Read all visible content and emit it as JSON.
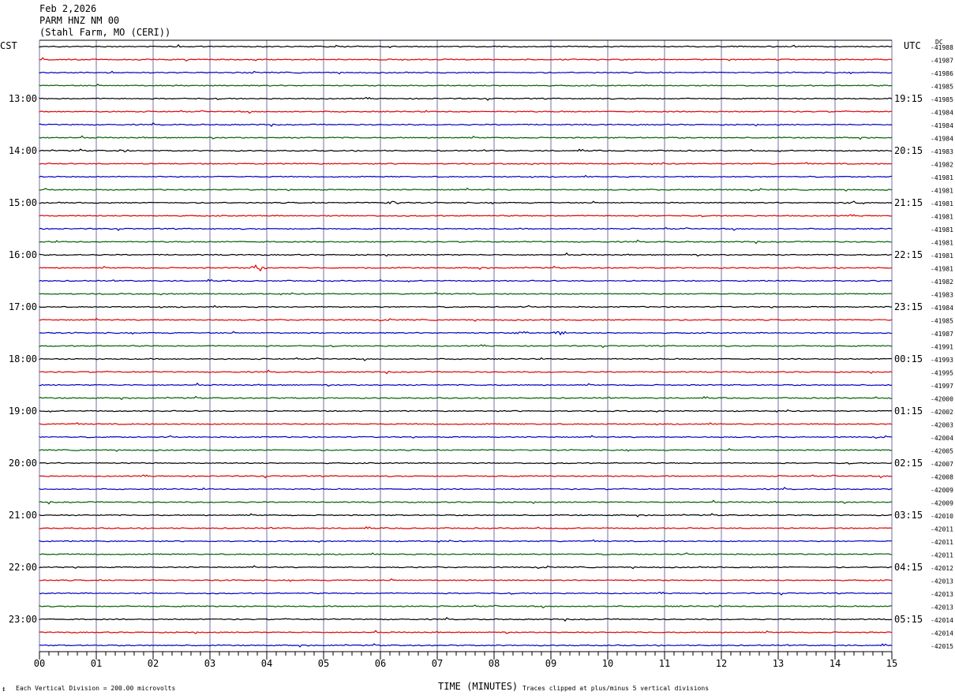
{
  "header": {
    "date": "Feb 2,2026",
    "station": "PARM HNZ NM 00",
    "location": "(Stahl Farm, MO (CERI))"
  },
  "labels": {
    "left_zone": "CST",
    "right_zone": "UTC",
    "dc": "DC",
    "xlabel": "TIME (MINUTES)",
    "scale_note": "Each Vertical Division =  200.00 microvolts",
    "clip_note": "Traces clipped at plus/minus 5 vertical divisions",
    "mark": "↕"
  },
  "chart_data": {
    "type": "line",
    "title": "PARM HNZ NM 00",
    "xlabel": "TIME (MINUTES)",
    "ylabel": "",
    "xlim": [
      0,
      15
    ],
    "x_ticks": [
      "00",
      "01",
      "02",
      "03",
      "04",
      "05",
      "06",
      "07",
      "08",
      "09",
      "10",
      "11",
      "12",
      "13",
      "14",
      "15"
    ],
    "trace_colors": [
      "#000000",
      "#e00000",
      "#0000c0",
      "#006000"
    ],
    "grid": true,
    "left_hour_labels": [
      "13:00",
      "14:00",
      "15:00",
      "16:00",
      "17:00",
      "18:00",
      "19:00",
      "20:00",
      "21:00",
      "22:00",
      "23:00"
    ],
    "right_hour_labels": [
      "19:15",
      "20:15",
      "21:15",
      "22:15",
      "23:15",
      "00:15",
      "01:15",
      "02:15",
      "03:15",
      "04:15",
      "05:15"
    ],
    "dc_values": [
      "-41988",
      "-41987",
      "-41986",
      "-41985",
      "-41985",
      "-41984",
      "-41984",
      "-41984",
      "-41983",
      "-41982",
      "-41981",
      "-41981",
      "-41981",
      "-41981",
      "-41981",
      "-41981",
      "-41981",
      "-41981",
      "-41982",
      "-41983",
      "-41984",
      "-41985",
      "-41987",
      "-41991",
      "-41993",
      "-41995",
      "-41997",
      "-42000",
      "-42002",
      "-42003",
      "-42004",
      "-42005",
      "-42007",
      "-42008",
      "-42009",
      "-42009",
      "-42010",
      "-42011",
      "-42011",
      "-42011",
      "-42012",
      "-42013",
      "-42013",
      "-42013",
      "-42014",
      "-42014",
      "-42015"
    ],
    "events": [
      {
        "row": 8,
        "minute": 1.5,
        "amp": 2
      },
      {
        "row": 12,
        "minute": 6.2,
        "amp": 2
      },
      {
        "row": 12,
        "minute": 14.3,
        "amp": 2
      },
      {
        "row": 17,
        "minute": 3.85,
        "amp": 5
      },
      {
        "row": 22,
        "minute": 8.5,
        "amp": 2
      },
      {
        "row": 22,
        "minute": 9.15,
        "amp": 3
      }
    ],
    "scale_microvolts_per_division": 200.0,
    "clip_divisions": 5
  }
}
